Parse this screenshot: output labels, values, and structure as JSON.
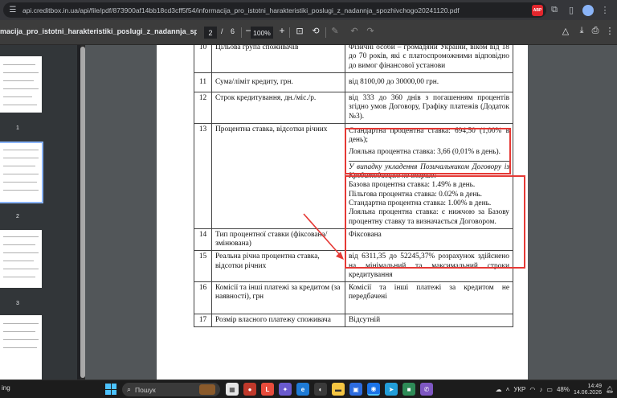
{
  "browser": {
    "url": "api.creditbox.in.ua/api/file/pdf/873900af14bb18cd3cff5f54/informacija_pro_istotni_harakteristiki_poslugi_z_nadannja_spozhivchogo20241120.pdf",
    "abp_label": "ABP"
  },
  "pdf_toolbar": {
    "filename": "macija_pro_istotni_harakteristiki_poslugi_z_nadannja_spozhivchogo20...",
    "current_page": "2",
    "page_separator": "/",
    "total_pages": "6",
    "zoom": "100%"
  },
  "sidebar": {
    "thumbnails": [
      {
        "number": "1"
      },
      {
        "number": "2"
      },
      {
        "number": "3"
      }
    ]
  },
  "table": {
    "rows": [
      {
        "num": "10",
        "label": "Цільова група споживачів",
        "value": "Фізичні особи – громадяни України, віком від 18 до 70 років, які є платоспроможними відповідно до вимог фінансової установи"
      },
      {
        "num": "11",
        "label": "Сума/ліміт кредиту, грн.",
        "value": "від 8100,00 до 30000,00 грн."
      },
      {
        "num": "12",
        "label": "Строк кредитування, дн./міс./р.",
        "value": "від 333 до 360 днів з погашенням процентів згідно умов Договору, Графіку платежів (Додаток №3)."
      },
      {
        "num": "13",
        "label": "Процентна ставка, відсотки річних",
        "value_standard": "Стандартна процентна ставка: 694,50 (1,00% в день);",
        "value_loyal": "Лояльна процентна ставка: 3,66 (0,01% в день).",
        "first_title": "У випадку укладення Позичальником Договору із Кредитодавцем не вперше:",
        "first_base": "Базова процентна ставка: 1.49% в день.",
        "first_pref": "Пільгова процентна ставка: 0.02% в день.",
        "first_standard": "Стандартна процентна ставка: 1.00% в день.",
        "first_loyal": "Лояльна процентна ставка: є нижчою за Базову процентну ставку та визначається Договором."
      },
      {
        "num": "14",
        "label": "Тип процентної ставки (фіксована/змінювана)",
        "value": "Фіксована"
      },
      {
        "num": "15",
        "label": "Реальна річна процентна ставка, відсотки річних",
        "value": "від 6311,35 до 52245,37% розрахунок здійснено на мінімальний та максимальний строки кредитування"
      },
      {
        "num": "16",
        "label": "Комісії та інші платежі за кредитом (за наявності), грн",
        "value": "Комісії та інші платежі за кредитом не передбачені"
      },
      {
        "num": "17",
        "label": "Розмір власного платежу споживача",
        "value": "Відсутній"
      }
    ]
  },
  "taskbar": {
    "left_text": "ing",
    "search_text": "Пошук",
    "language": "УКР",
    "battery": "48%",
    "time": "14:49",
    "date": "14.06.2026"
  },
  "colors": {
    "annotation_red": "#e53935",
    "chrome_bg": "#35363a",
    "toolbar_bg": "#3c3c3c",
    "viewer_bg": "#525659"
  }
}
